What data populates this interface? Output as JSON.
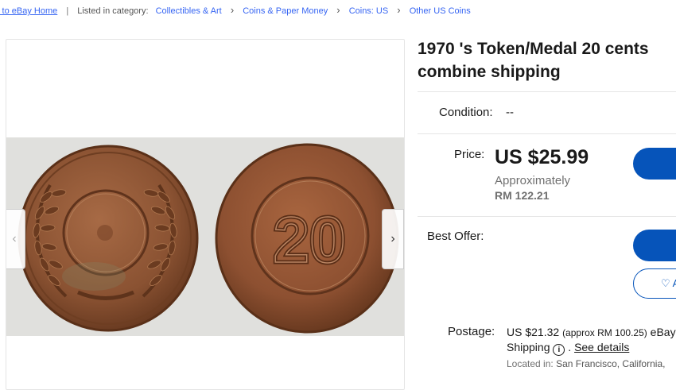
{
  "breadcrumb": {
    "back": "k to eBay Home",
    "listed_in": "Listed in category:",
    "items": [
      "Collectibles & Art",
      "Coins & Paper Money",
      "Coins: US",
      "Other US Coins"
    ]
  },
  "image": {
    "coin_right_text": "20",
    "next_arrow": "›",
    "prev_arrow": "‹"
  },
  "title": {
    "line1": "1970 's Token/Medal 20 cents",
    "line2": "combine shipping"
  },
  "condition": {
    "label": "Condition:",
    "value": "--"
  },
  "price": {
    "label": "Price:",
    "value": "US $25.99",
    "approx": "Approximately",
    "converted": "RM 122.21"
  },
  "best_offer": {
    "label": "Best Offer:"
  },
  "watch_button": {
    "icon": "heart-icon",
    "label_partial": "A"
  },
  "shipping": {
    "label": "Postage:",
    "amount": "US $21.32",
    "approx": "(approx RM 100.25)",
    "carrier_partial": "eBay",
    "line2": "Shipping",
    "see_details": "See details",
    "located_label": "Located in:",
    "located_value": "San Francisco, California,"
  },
  "colors": {
    "link": "#3665f3",
    "button": "#0654ba",
    "muted": "#707070"
  }
}
